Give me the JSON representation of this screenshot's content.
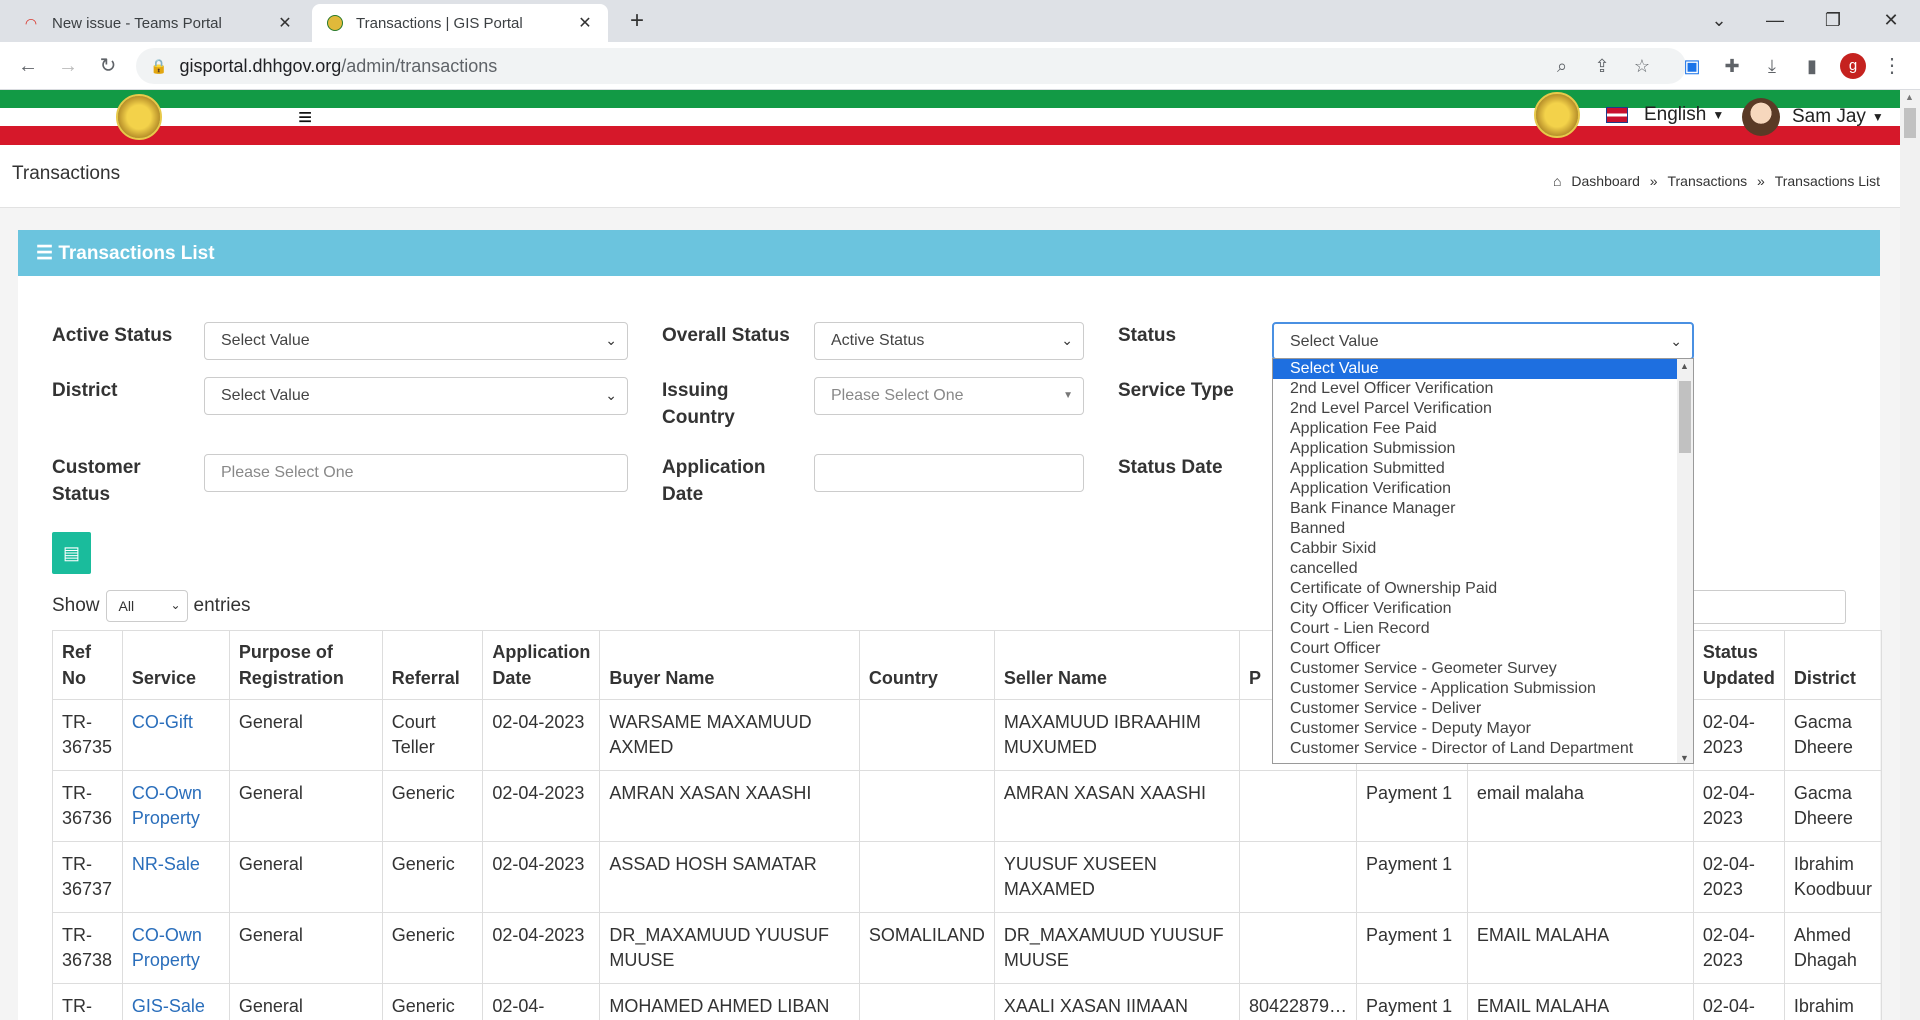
{
  "browser": {
    "tabs": [
      {
        "title": "New issue - Teams Portal",
        "icon": "teams-icon",
        "active": false
      },
      {
        "title": "Transactions | GIS Portal",
        "icon": "gis-emblem-icon",
        "active": true
      }
    ],
    "url_host": "gisportal.dhhgov.org",
    "url_path": "/admin/transactions",
    "profile_initial": "g"
  },
  "header": {
    "language": "English",
    "user_name": "Sam Jay"
  },
  "page": {
    "title": "Transactions",
    "breadcrumb": [
      "Dashboard",
      "Transactions",
      "Transactions List"
    ],
    "card_title": "Transactions List"
  },
  "filters": {
    "active_status": {
      "label": "Active Status",
      "value": "Select Value"
    },
    "overall_status": {
      "label": "Overall Status",
      "value": "Active Status"
    },
    "status": {
      "label": "Status",
      "value": "Select Value"
    },
    "district": {
      "label": "District",
      "value": "Select Value"
    },
    "issuing_country": {
      "label_1": "Issuing",
      "label_2": "Country",
      "value": "Please Select One"
    },
    "service_type": {
      "label": "Service Type"
    },
    "customer_status": {
      "label_1": "Customer",
      "label_2": "Status",
      "value": "Please Select One"
    },
    "application_date": {
      "label_1": "Application",
      "label_2": "Date",
      "value": ""
    },
    "status_date": {
      "label": "Status Date"
    }
  },
  "status_dropdown": {
    "options": [
      "Select Value",
      "2nd Level Officer Verification",
      "2nd Level Parcel Verification",
      "Application Fee Paid",
      "Application Submission",
      "Application Submitted",
      "Application Verification",
      "Bank Finance Manager",
      "Banned",
      "Cabbir Sixid",
      "cancelled",
      "Certificate of Ownership Paid",
      "City Officer Verification",
      "Court - Lien Record",
      "Court Officer",
      "Customer Service - Geometer Survey",
      "Customer Service - Application Submission",
      "Customer Service - Deliver",
      "Customer Service - Deputy Mayor",
      "Customer Service - Director of Land Department"
    ],
    "selected_index": 0
  },
  "table_controls": {
    "show_label": "Show",
    "show_value": "All",
    "entries_label": "entries"
  },
  "table": {
    "headers": [
      "Ref No",
      "Service",
      "Purpose of Registration",
      "Referral",
      "Application Date",
      "Buyer Name",
      "Country",
      "Seller Name",
      "P",
      "",
      "",
      "Status Updated",
      "District"
    ],
    "rows": [
      {
        "ref": "TR-36735",
        "service": "CO-Gift",
        "purpose": "General",
        "referral": "Court Teller",
        "date": "02-04-2023",
        "buyer": "WARSAME MAXAMUUD AXMED",
        "country": "",
        "seller": "MAXAMUUD IBRAAHIM MUXUMED",
        "p": "",
        "payment": "",
        "note": "",
        "updated": "02-04-2023",
        "district": "Gacma Dheere"
      },
      {
        "ref": "TR-36736",
        "service": "CO-Own Property",
        "purpose": "General",
        "referral": "Generic",
        "date": "02-04-2023",
        "buyer": "AMRAN XASAN XAASHI",
        "country": "",
        "seller": "AMRAN XASAN XAASHI",
        "p": "",
        "payment": "Payment 1",
        "note": "email malaha",
        "updated": "02-04-2023",
        "district": "Gacma Dheere"
      },
      {
        "ref": "TR-36737",
        "service": "NR-Sale",
        "purpose": "General",
        "referral": "Generic",
        "date": "02-04-2023",
        "buyer": "ASSAD HOSH SAMATAR",
        "country": "",
        "seller": "YUUSUF XUSEEN MAXAMED",
        "p": "",
        "payment": "Payment 1",
        "note": "",
        "updated": "02-04-2023",
        "district": "Ibrahim Koodbuur"
      },
      {
        "ref": "TR-36738",
        "service": "CO-Own Property",
        "purpose": "General",
        "referral": "Generic",
        "date": "02-04-2023",
        "buyer": "DR_MAXAMUUD YUUSUF MUUSE",
        "country": "SOMALILAND",
        "seller": "DR_MAXAMUUD YUUSUF MUUSE",
        "p": "",
        "payment": "Payment 1",
        "note": "EMAIL MALAHA",
        "updated": "02-04-2023",
        "district": "Ahmed Dhagah"
      },
      {
        "ref": "TR-",
        "service": "GIS-Sale",
        "purpose": "General",
        "referral": "Generic",
        "date": "02-04-",
        "buyer": "MOHAMED AHMED LIBAN",
        "country": "",
        "seller": "XAALI XASAN IIMAAN",
        "p": "80422879…",
        "payment": "Payment 1",
        "note": "EMAIL MALAHA",
        "updated": "02-04-",
        "district": "Ibrahim"
      }
    ]
  }
}
